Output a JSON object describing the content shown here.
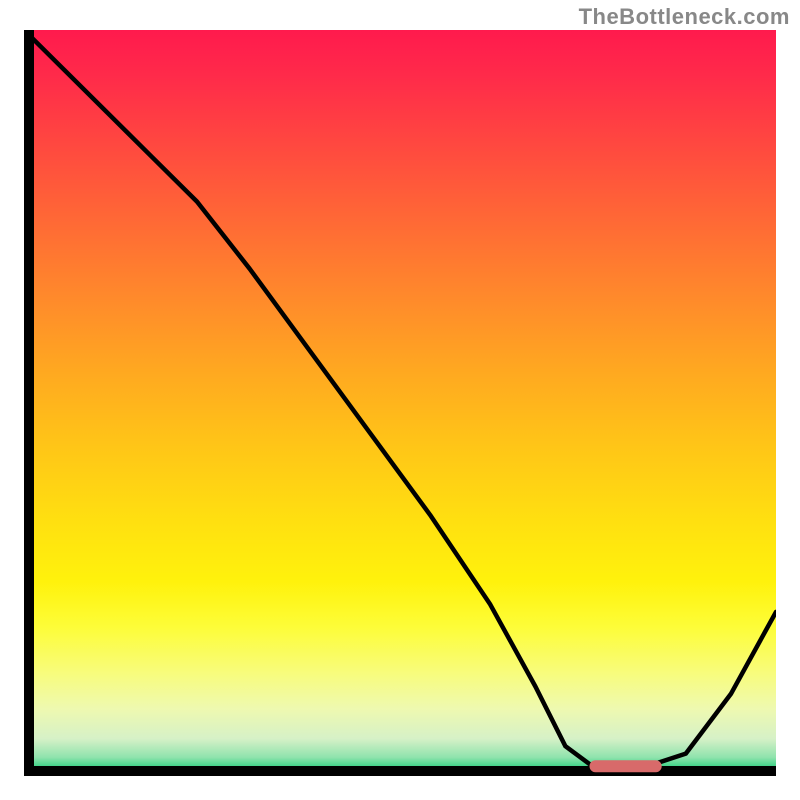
{
  "watermark": "TheBottleneck.com",
  "chart_data": {
    "type": "line",
    "title": "",
    "xlabel": "",
    "ylabel": "",
    "xlim": [
      0,
      100
    ],
    "ylim": [
      0,
      100
    ],
    "grid": false,
    "series": [
      {
        "name": "bottleneck-curve",
        "x": [
          0,
          8,
          17,
          23,
          30,
          38,
          46,
          54,
          62,
          68,
          72,
          76,
          82,
          88,
          94,
          100
        ],
        "values": [
          100,
          92,
          83,
          77,
          68,
          57,
          46,
          35,
          23,
          12,
          4,
          1,
          1,
          3,
          11,
          22
        ]
      }
    ],
    "annotations": [
      {
        "name": "optimal-range-marker",
        "type": "segment",
        "x0": 76,
        "x1": 84,
        "y": 1.3,
        "color": "#d86a6a",
        "thickness": 12
      }
    ],
    "background": {
      "type": "vertical-gradient",
      "description": "red (top) → orange → yellow → pale yellow → green (bottom)",
      "stops": [
        {
          "pos": 0.0,
          "color": "#ff1a4d"
        },
        {
          "pos": 0.36,
          "color": "#ff8a2b"
        },
        {
          "pos": 0.66,
          "color": "#ffe010"
        },
        {
          "pos": 0.91,
          "color": "#eef9b0"
        },
        {
          "pos": 1.0,
          "color": "#1cca72"
        }
      ]
    }
  },
  "marker": {
    "color": "#d86a6a",
    "thickness": 12
  }
}
